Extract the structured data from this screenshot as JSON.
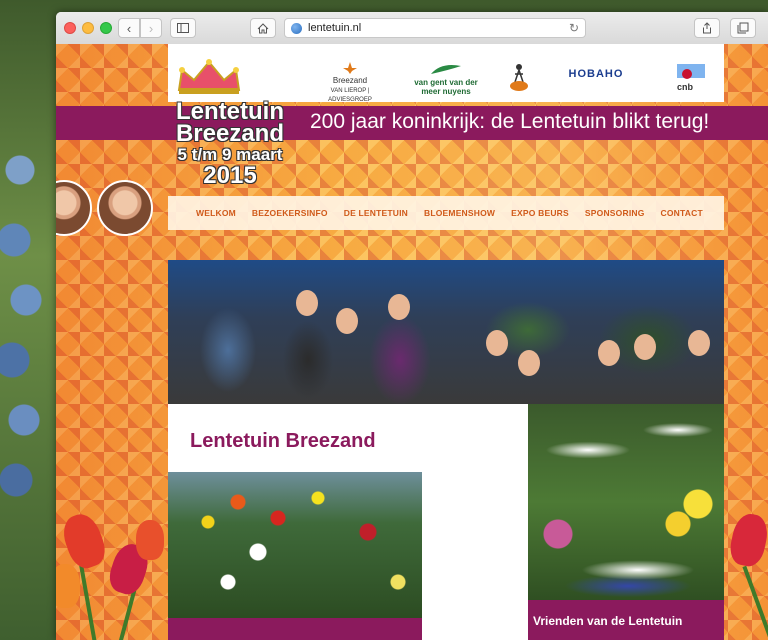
{
  "browser": {
    "url": "lentetuin.nl",
    "icons": {
      "back": "chevron-left-icon",
      "forward": "chevron-right-icon",
      "sidebar": "sidebar-icon",
      "home": "home-icon",
      "reload": "reload-icon",
      "share": "share-icon",
      "tabs": "tabs-icon"
    }
  },
  "logo": {
    "line1": "Lentetuin",
    "line2": "Breezand",
    "line3": "5 t/m 9 maart",
    "line4": "2015"
  },
  "sponsors": [
    {
      "name": "Breezand",
      "subtitle": "VAN LIEROP | ADVIESGROEP"
    },
    {
      "name": "van gent van der meer nuyens"
    },
    {
      "name": ""
    },
    {
      "name": "HOBAHO"
    },
    {
      "name": "cnb"
    }
  ],
  "banner": {
    "text": "200 jaar koninkrijk: de Lentetuin blikt terug!"
  },
  "nav": {
    "items": [
      "WELKOM",
      "BEZOEKERSINFO",
      "DE LENTETUIN",
      "BLOEMENSHOW",
      "EXPO BEURS",
      "SPONSORING",
      "CONTACT"
    ]
  },
  "content": {
    "title": "Lentetuin Breezand"
  },
  "side": {
    "caption": "Vrienden van de Lentetuin"
  },
  "colors": {
    "brand_purple": "#8b1a5d",
    "nav_orange": "#d05a1a",
    "background_orange": "#f6a233"
  }
}
